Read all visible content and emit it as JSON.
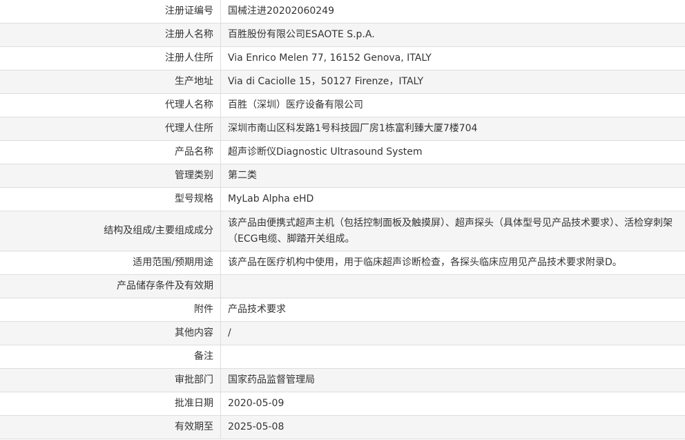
{
  "rows": [
    {
      "label": "注册证编号",
      "value": "国械注进20202060249"
    },
    {
      "label": "注册人名称",
      "value": "百胜股份有限公司ESAOTE S.p.A."
    },
    {
      "label": "注册人住所",
      "value": "Via Enrico Melen 77, 16152 Genova, ITALY"
    },
    {
      "label": "生产地址",
      "value": "Via di Caciolle 15，50127 Firenze，ITALY"
    },
    {
      "label": "代理人名称",
      "value": "百胜（深圳）医疗设备有限公司"
    },
    {
      "label": "代理人住所",
      "value": "深圳市南山区科发路1号科技园厂房1栋富利臻大厦7楼704"
    },
    {
      "label": "产品名称",
      "value": "超声诊断仪Diagnostic Ultrasound System"
    },
    {
      "label": "管理类别",
      "value": "第二类"
    },
    {
      "label": "型号规格",
      "value": "MyLab Alpha eHD"
    },
    {
      "label": "结构及组成/主要组成成分",
      "value": "该产品由便携式超声主机（包括控制面板及触摸屏）、超声探头（具体型号见产品技术要求）、活检穿刺架（ECG电缆、脚踏开关组成。"
    },
    {
      "label": "适用范围/预期用途",
      "value": "该产品在医疗机构中使用，用于临床超声诊断检查，各探头临床应用见产品技术要求附录D。"
    },
    {
      "label": "产品储存条件及有效期",
      "value": ""
    },
    {
      "label": "附件",
      "value": "产品技术要求"
    },
    {
      "label": "其他内容",
      "value": "/"
    },
    {
      "label": "备注",
      "value": ""
    },
    {
      "label": "审批部门",
      "value": "国家药品监督管理局"
    },
    {
      "label": "批准日期",
      "value": "2020-05-09"
    },
    {
      "label": "有效期至",
      "value": "2025-05-08"
    }
  ]
}
